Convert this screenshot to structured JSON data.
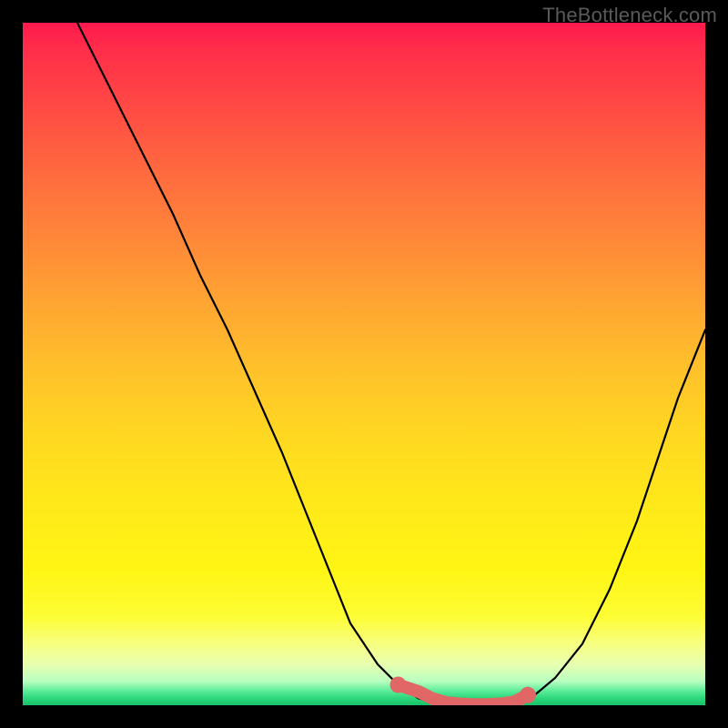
{
  "watermark": {
    "text": "TheBottleneck.com"
  },
  "colors": {
    "background": "#000000",
    "curve": "#000000",
    "marker": "#e06766",
    "gradient_top": "#ff1a4d",
    "gradient_bottom": "#17c169"
  },
  "chart_data": {
    "type": "line",
    "title": "",
    "xlabel": "",
    "ylabel": "",
    "xlim": [
      0,
      100
    ],
    "ylim": [
      0,
      100
    ],
    "grid": false,
    "legend": false,
    "series": [
      {
        "name": "bottleneck-curve",
        "x": [
          8,
          10,
          12,
          15,
          18,
          22,
          26,
          30,
          34,
          38,
          42,
          44,
          46,
          48,
          52,
          55,
          58,
          62,
          64,
          66,
          68,
          70,
          72,
          75,
          78,
          82,
          86,
          90,
          93,
          96,
          100
        ],
        "y": [
          100,
          96,
          92,
          86,
          80,
          72,
          63,
          55,
          46,
          37,
          27,
          22,
          17,
          12,
          6,
          3,
          1,
          0,
          0,
          0,
          0,
          0,
          0.3,
          1.5,
          4,
          9,
          17,
          27,
          36,
          45,
          55
        ]
      }
    ],
    "markers": {
      "name": "highlighted-range",
      "x": [
        55,
        58,
        60,
        62,
        64,
        66,
        68,
        70,
        72,
        74
      ],
      "y": [
        3,
        2,
        1,
        0.4,
        0.2,
        0.1,
        0.1,
        0.2,
        0.5,
        1.5
      ]
    }
  }
}
